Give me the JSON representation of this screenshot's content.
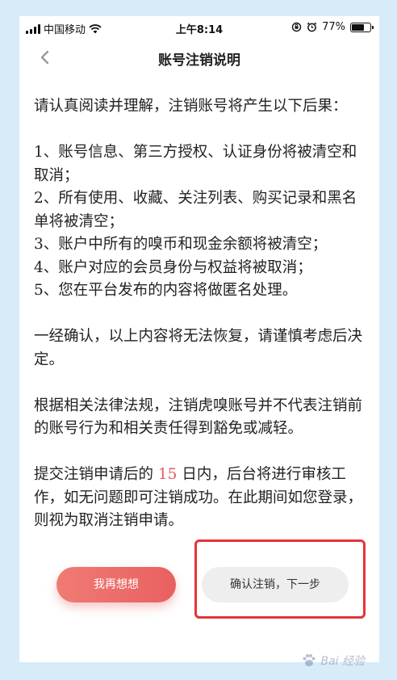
{
  "status_bar": {
    "carrier": "中国移动",
    "time": "上午8:14",
    "battery": "77%",
    "battery_level": 0.77
  },
  "nav": {
    "title": "账号注销说明"
  },
  "content": {
    "intro": "请认真阅读并理解，注销账号将产生以下后果：",
    "items": [
      "1、账号信息、第三方授权、认证身份将被清空和取消；",
      "2、所有使用、收藏、关注列表、购买记录和黑名单将被清空；",
      "3、账户中所有的嗅币和现金余额将被清空；",
      "4、账户对应的会员身份与权益将被取消；",
      "5、您在平台发布的内容将做匿名处理。"
    ],
    "confirm_note": "一经确认，以上内容将无法恢复，请谨慎考虑后决定。",
    "law_note": "根据相关法律法规，注销虎嗅账号并不代表注销前的账号行为和相关责任得到豁免或减轻。",
    "review_prefix": "提交注销申请后的 ",
    "review_days": "15",
    "review_suffix": " 日内，后台将进行审核工作，如无问题即可注销成功。在此期间如您登录，则视为取消注销申请。"
  },
  "buttons": {
    "rethink": "我再想想",
    "confirm": "确认注销，下一步"
  },
  "watermark": {
    "text": "Bai 经验"
  },
  "colors": {
    "accent": "#e86060",
    "highlight": "#e3353a",
    "frame": "#d8ebf8"
  }
}
